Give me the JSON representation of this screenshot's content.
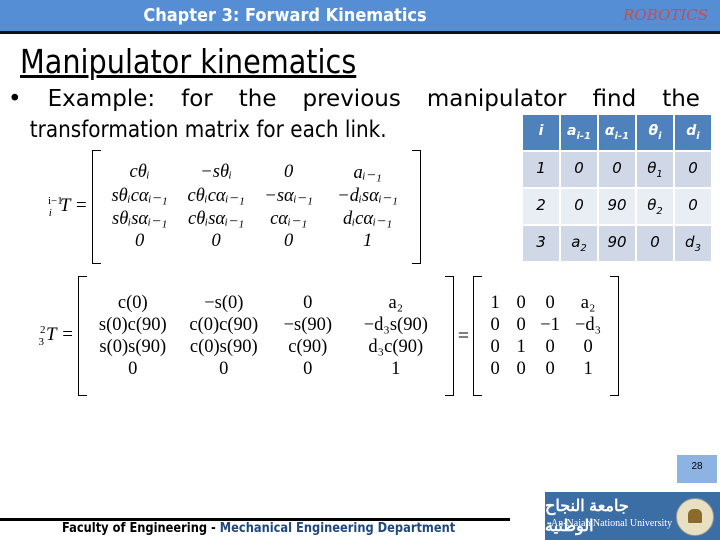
{
  "header": {
    "title": "Chapter 3: Forward Kinematics",
    "brand": "ROBOTICS"
  },
  "slide": {
    "title": "Manipulator kinematics",
    "bullet_marker": "•",
    "bullet_line1_words": [
      "Example:",
      "for",
      "the",
      "previous",
      "manipulator",
      "find",
      "the"
    ],
    "bullet_line2": "transformation matrix for each link."
  },
  "dh_table": {
    "headers": [
      "i",
      "a",
      "α",
      "θ",
      "d"
    ],
    "header_subs": [
      "",
      "i-1",
      "i-1",
      "i",
      "i"
    ],
    "rows": [
      [
        {
          "v": "1",
          "s": ""
        },
        {
          "v": "0",
          "s": ""
        },
        {
          "v": "0",
          "s": ""
        },
        {
          "v": "θ",
          "s": "1"
        },
        {
          "v": "0",
          "s": ""
        }
      ],
      [
        {
          "v": "2",
          "s": ""
        },
        {
          "v": "0",
          "s": ""
        },
        {
          "v": "90",
          "s": ""
        },
        {
          "v": "θ",
          "s": "2"
        },
        {
          "v": "0",
          "s": ""
        }
      ],
      [
        {
          "v": "3",
          "s": ""
        },
        {
          "v": "a",
          "s": "2"
        },
        {
          "v": "90",
          "s": ""
        },
        {
          "v": "0",
          "s": ""
        },
        {
          "v": "d",
          "s": "3"
        }
      ]
    ]
  },
  "general_matrix": {
    "lhs_sup": "i−1",
    "lhs_sub": "i",
    "lhs": "T =",
    "cells": [
      [
        "cθᵢ",
        "−sθᵢ",
        "0",
        "aᵢ₋₁"
      ],
      [
        "sθᵢcαᵢ₋₁",
        "cθᵢcαᵢ₋₁",
        "−sαᵢ₋₁",
        "−dᵢsαᵢ₋₁"
      ],
      [
        "sθᵢsαᵢ₋₁",
        "cθᵢsαᵢ₋₁",
        "cαᵢ₋₁",
        "dᵢcαᵢ₋₁"
      ],
      [
        "0",
        "0",
        "0",
        "1"
      ]
    ]
  },
  "link3_matrix": {
    "lhs_sup": "2",
    "lhs_sub": "3",
    "lhs": "T =",
    "cells": [
      [
        "c(0)",
        "−s(0)",
        "0",
        "a₂"
      ],
      [
        "s(0)c(90)",
        "c(0)c(90)",
        "−s(90)",
        "−d₃s(90)"
      ],
      [
        "s(0)s(90)",
        "c(0)s(90)",
        "c(90)",
        "d₃c(90)"
      ],
      [
        "0",
        "0",
        "0",
        "1"
      ]
    ],
    "equals": "=",
    "result": [
      [
        "1",
        "0",
        "0",
        "a₂"
      ],
      [
        "0",
        "0",
        "−1",
        "−d₃"
      ],
      [
        "0",
        "1",
        "0",
        "0"
      ],
      [
        "0",
        "0",
        "0",
        "1"
      ]
    ]
  },
  "page_number": "28",
  "footer": {
    "faculty": "Faculty of Engineering - ",
    "department": "Mechanical Engineering Department"
  },
  "logo": {
    "arabic": "جامعة النجاح الوطنية",
    "english": "An-Najah National University"
  }
}
